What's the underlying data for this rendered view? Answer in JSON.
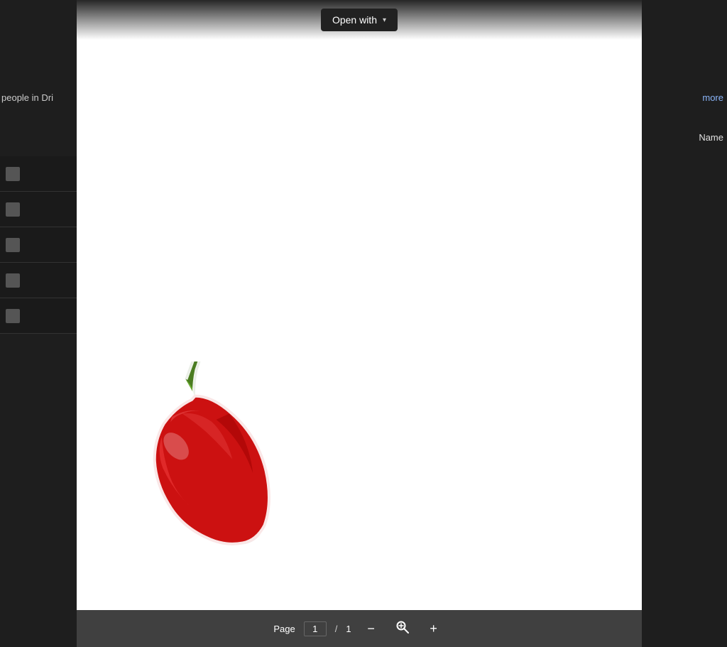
{
  "background": {
    "color": "#2a2a2a"
  },
  "drive_fragments": {
    "left_text": "people in Dri",
    "right_more": "more",
    "right_name": "Name"
  },
  "top_bar": {
    "open_with_label": "Open with",
    "chevron": "▾"
  },
  "doc_viewer": {
    "background": "#ffffff"
  },
  "bottom_toolbar": {
    "page_label": "Page",
    "page_current": "1",
    "page_separator": "/",
    "page_total": "1",
    "zoom_out_icon": "−",
    "zoom_in_icon": "+",
    "zoom_reset_icon": "⊙"
  }
}
